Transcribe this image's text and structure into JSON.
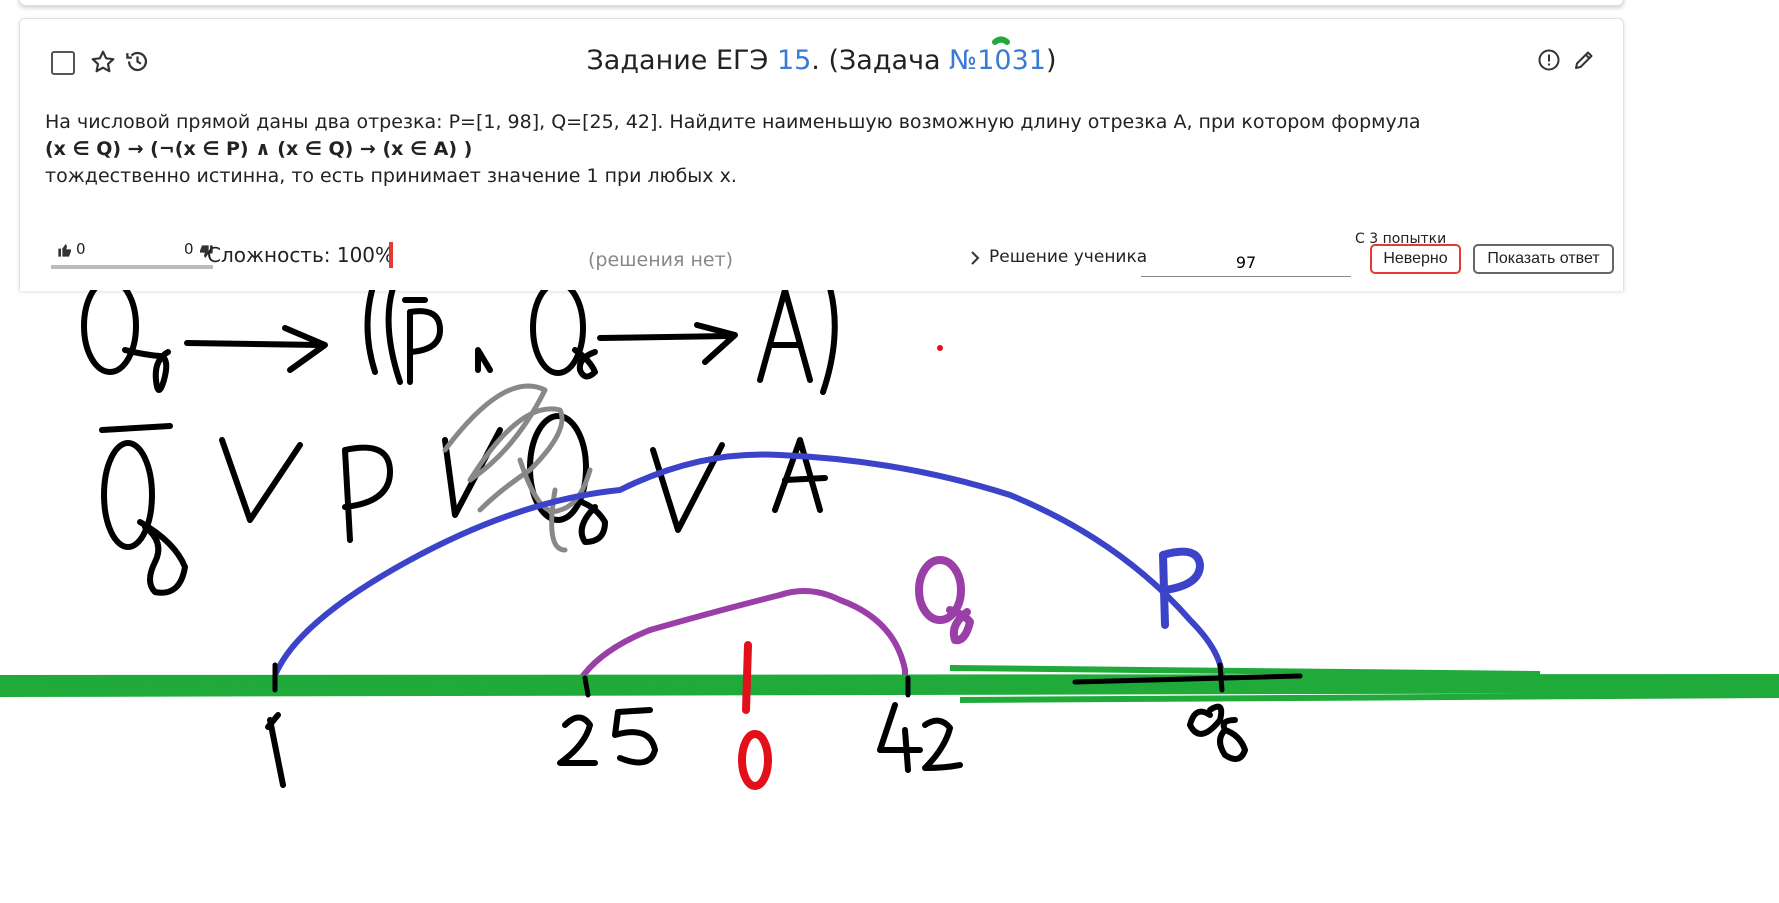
{
  "task": {
    "title_prefix": "Задание ЕГЭ ",
    "ege_number": "15",
    "title_middle": ". (Задача ",
    "task_number": "№1031",
    "title_suffix": ")",
    "statement_line1": "На числовой прямой даны два отрезка: P=[1, 98], Q=[25, 42]. Найдите наименьшую возможную длину отрезка A, при котором формула",
    "formula": "(x ∈ Q) → (¬(x ∈ P) ∧ (x ∈ Q) → (x ∈ A) )",
    "statement_line3": "тождественно истинна, то есть принимает значение 1 при любых x."
  },
  "rating": {
    "likes": "0",
    "dislikes": "0"
  },
  "difficulty": {
    "label": "Сложность: 100%",
    "value": 1.0,
    "bar_color": "#e53935"
  },
  "solution": {
    "none_text": "(решения нет)",
    "student_solution_label": "Решение ученика"
  },
  "answer": {
    "attempts_label": "С 3 попытки",
    "value": "97",
    "wrong_label": "Неверно",
    "show_answer_label": "Показать ответ"
  },
  "drawing": {
    "handwriting_row1": "Q → ((P̄ ∧ Q) → A)",
    "handwriting_row2": "Q̄ ∨ P ∨ Q ∨ A",
    "interval_labels": [
      "1",
      "25",
      "42",
      "98"
    ],
    "mark_0": "0",
    "curve_labels": [
      "P",
      "Q"
    ],
    "colors": {
      "P": "#3b44c9",
      "Q": "#9b3fa8",
      "axis": "#1faa3a",
      "mark": "#e3101b",
      "ink": "#000000",
      "scratch": "#888888"
    }
  }
}
